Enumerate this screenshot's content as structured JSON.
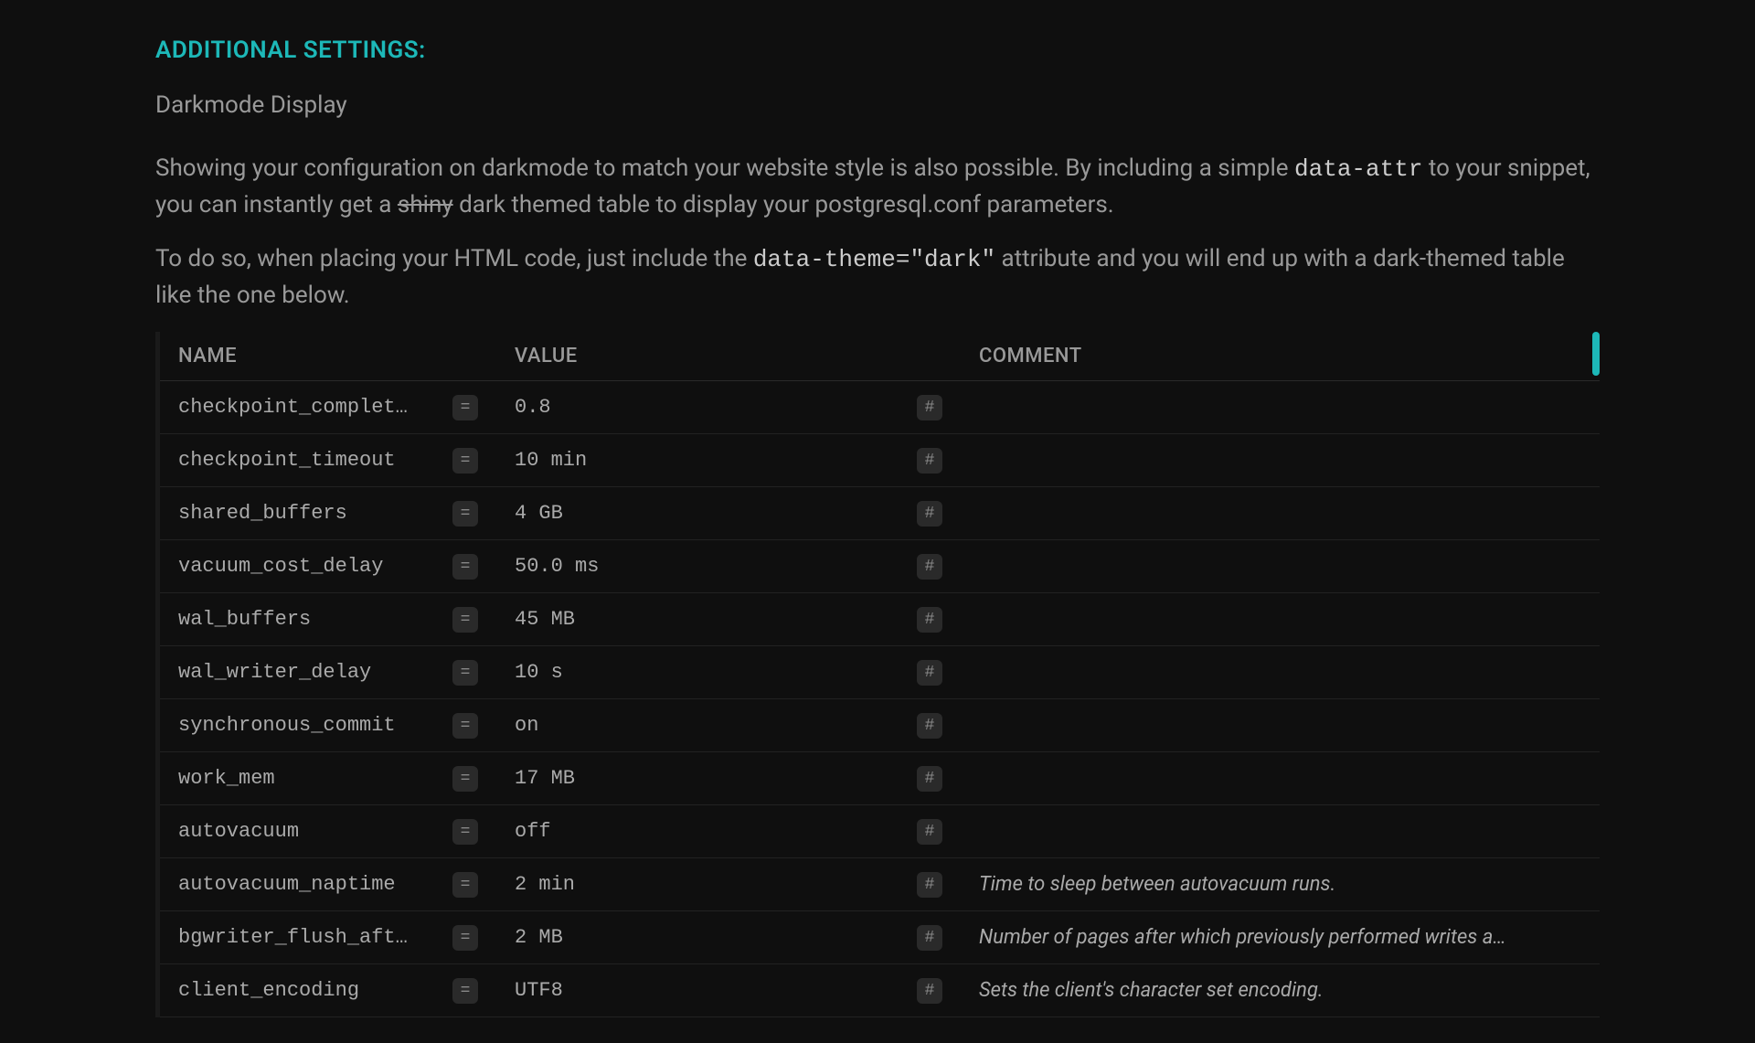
{
  "section": {
    "header": "ADDITIONAL SETTINGS:",
    "subtitle": "Darkmode Display",
    "para1_a": "Showing your configuration on darkmode to match your website style is also possible. By including a simple ",
    "para1_code": "data-attr",
    "para1_b": " to your snippet, you can instantly get a ",
    "para1_strike": "shiny",
    "para1_c": " dark themed table to display your postgresql.conf parameters.",
    "para2_a": "To do so, when placing your HTML code, just include the ",
    "para2_code": "data-theme=\"dark\"",
    "para2_b": " attribute and you will end up with a dark-themed table like the one below."
  },
  "table": {
    "headers": {
      "name": "NAME",
      "value": "VALUE",
      "comment": "COMMENT"
    },
    "eq_symbol": "=",
    "hash_symbol": "#",
    "rows": [
      {
        "name": "checkpoint_completion_t…",
        "value": "0.8",
        "comment": ""
      },
      {
        "name": "checkpoint_timeout",
        "value": "10 min",
        "comment": ""
      },
      {
        "name": "shared_buffers",
        "value": "4 GB",
        "comment": ""
      },
      {
        "name": "vacuum_cost_delay",
        "value": "50.0 ms",
        "comment": ""
      },
      {
        "name": "wal_buffers",
        "value": "45 MB",
        "comment": ""
      },
      {
        "name": "wal_writer_delay",
        "value": "10 s",
        "comment": ""
      },
      {
        "name": "synchronous_commit",
        "value": "on",
        "comment": ""
      },
      {
        "name": "work_mem",
        "value": "17 MB",
        "comment": ""
      },
      {
        "name": "autovacuum",
        "value": "off",
        "comment": ""
      },
      {
        "name": "autovacuum_naptime",
        "value": "2 min",
        "comment": "Time to sleep between autovacuum runs."
      },
      {
        "name": "bgwriter_flush_after",
        "value": "2 MB",
        "comment": "Number of pages after which previously performed writes a…"
      },
      {
        "name": "client_encoding",
        "value": "UTF8",
        "comment": "Sets the client's character set encoding."
      }
    ]
  }
}
